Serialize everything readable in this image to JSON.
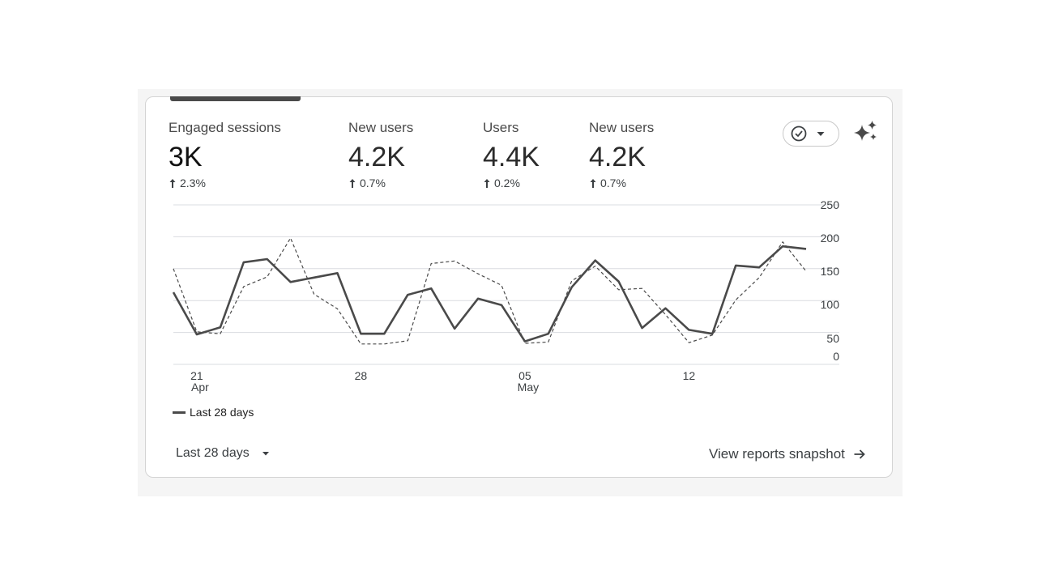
{
  "metrics": [
    {
      "label": "Engaged sessions",
      "value": "3K",
      "change": "2.3%",
      "direction": "up"
    },
    {
      "label": "New users",
      "value": "4.2K",
      "change": "0.7%",
      "direction": "up"
    },
    {
      "label": "Users",
      "value": "4.4K",
      "change": "0.2%",
      "direction": "up"
    },
    {
      "label": "New users",
      "value": "4.2K",
      "change": "0.7%",
      "direction": "up"
    }
  ],
  "icons": {
    "compare": "check-circle-icon",
    "dropdown": "caret-down-icon",
    "insights": "sparkle-icon",
    "up": "arrow-up-icon",
    "forward": "arrow-right-icon"
  },
  "legend": {
    "label": "Last 28 days"
  },
  "footer": {
    "date_range_label": "Last 28 days",
    "view_link_label": "View reports snapshot"
  },
  "colors": {
    "primary_line": "#4a4a4a",
    "comparison_line": "#4a4a4a",
    "grid": "#dadce0"
  },
  "chart_data": {
    "type": "line",
    "x": [
      "2024-04-20",
      "2024-04-21",
      "2024-04-22",
      "2024-04-23",
      "2024-04-24",
      "2024-04-25",
      "2024-04-26",
      "2024-04-27",
      "2024-04-28",
      "2024-04-29",
      "2024-04-30",
      "2024-05-01",
      "2024-05-02",
      "2024-05-03",
      "2024-05-04",
      "2024-05-05",
      "2024-05-06",
      "2024-05-07",
      "2024-05-08",
      "2024-05-09",
      "2024-05-10",
      "2024-05-11",
      "2024-05-12",
      "2024-05-13",
      "2024-05-14",
      "2024-05-15",
      "2024-05-16",
      "2024-05-17"
    ],
    "x_tick_labels": [
      {
        "day": "21",
        "month": "Apr"
      },
      {
        "day": "28",
        "month": ""
      },
      {
        "day": "05",
        "month": "May"
      },
      {
        "day": "12",
        "month": ""
      }
    ],
    "y_ticks": [
      "250",
      "200",
      "150",
      "100",
      "50",
      "0"
    ],
    "ylim": [
      0,
      250
    ],
    "series": [
      {
        "name": "Last 28 days",
        "style": "solid",
        "values": [
          113,
          47,
          58,
          160,
          165,
          129,
          136,
          143,
          48,
          48,
          109,
          119,
          56,
          103,
          93,
          36,
          48,
          121,
          163,
          130,
          57,
          88,
          54,
          48,
          155,
          152,
          185,
          181
        ]
      },
      {
        "style": "dashed",
        "values": [
          150,
          51,
          48,
          122,
          137,
          198,
          110,
          87,
          32,
          32,
          37,
          158,
          162,
          142,
          124,
          33,
          35,
          131,
          154,
          117,
          119,
          78,
          34,
          46,
          101,
          136,
          192,
          146
        ]
      }
    ],
    "grid": true
  }
}
